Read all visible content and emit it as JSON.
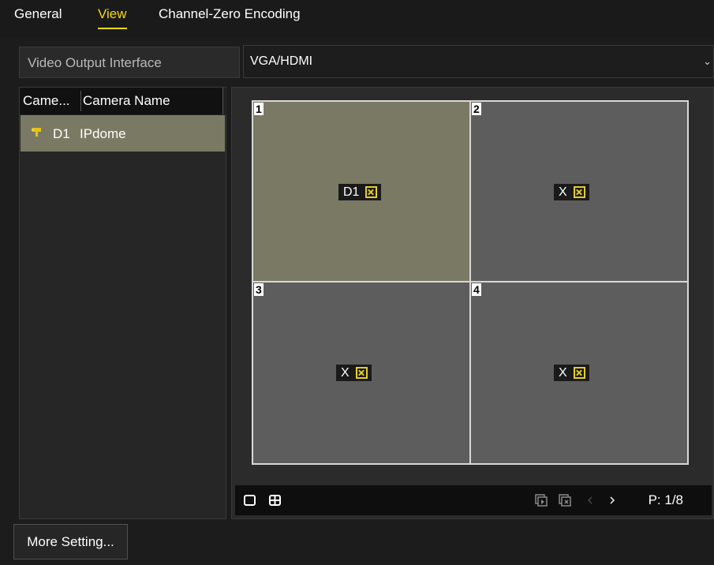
{
  "tabs": [
    {
      "label": "General"
    },
    {
      "label": "View"
    },
    {
      "label": "Channel-Zero Encoding"
    }
  ],
  "active_tab": "View",
  "accent_color": "#f5d90a",
  "output": {
    "label": "Video Output Interface",
    "value": "VGA/HDMI"
  },
  "camera_list": {
    "headers": [
      "Came...",
      "Camera Name"
    ],
    "rows": [
      {
        "id": "D1",
        "name": "IPdome",
        "icon": "camera-icon",
        "selected": true
      }
    ]
  },
  "grid": {
    "cells": [
      {
        "number": "1",
        "tag": "D1",
        "selected": true
      },
      {
        "number": "2",
        "tag": "X",
        "selected": false
      },
      {
        "number": "3",
        "tag": "X",
        "selected": false
      },
      {
        "number": "4",
        "tag": "X",
        "selected": false
      }
    ]
  },
  "toolbar": {
    "icons": [
      "single-layout-icon",
      "quad-layout-icon",
      "start-live-view-icon",
      "stop-live-view-icon",
      "prev-page-icon",
      "next-page-icon"
    ],
    "page": "P: 1/8"
  },
  "more_setting_label": "More Setting..."
}
